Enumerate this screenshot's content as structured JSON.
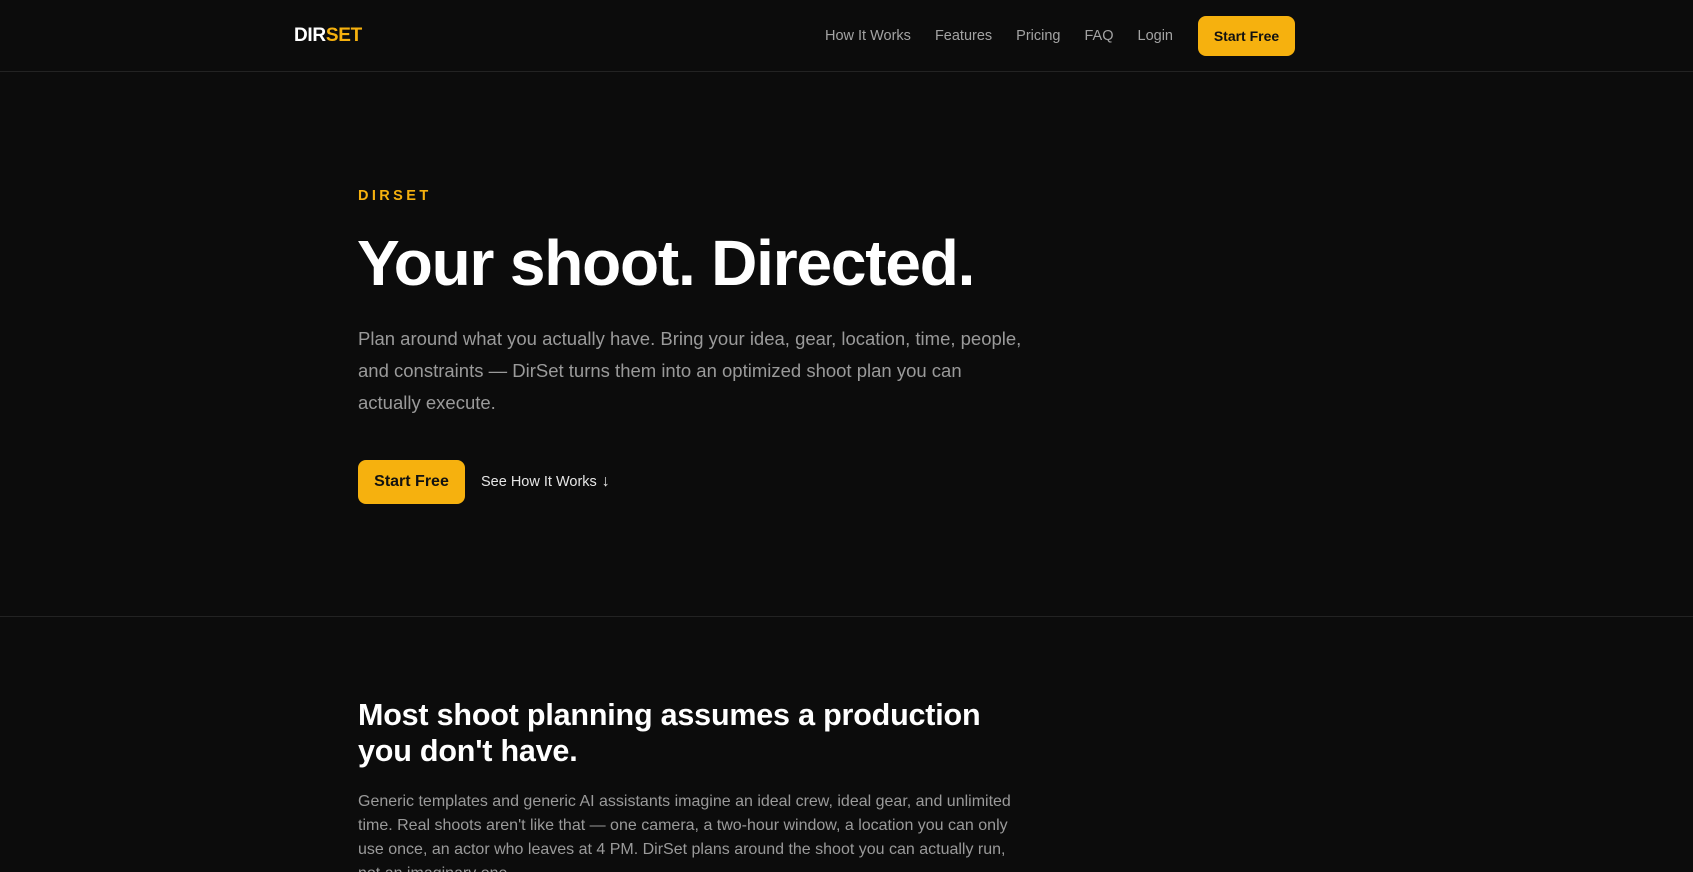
{
  "brand": {
    "logo_part1": "DIR",
    "logo_part2": "SET",
    "accent": "#f6b10e"
  },
  "nav": {
    "links": [
      "How It Works",
      "Features",
      "Pricing",
      "FAQ",
      "Login"
    ],
    "cta_label": "Start Free"
  },
  "hero": {
    "eyebrow": "DIRSET",
    "title": "Your shoot. Directed.",
    "subtitle": "Plan around what you actually have. Bring your idea, gear, location, time, people, and constraints — DirSet turns them into an optimized shoot plan you can actually execute.",
    "primary_cta": "Start Free",
    "secondary_cta": "See How It Works",
    "secondary_cta_icon": "↓"
  },
  "problem": {
    "title": "Most shoot planning assumes a production you don't have.",
    "body": "Generic templates and generic AI assistants imagine an ideal crew, ideal gear, and unlimited time. Real shoots aren't like that — one camera, a two-hour window, a location you can only use once, an actor who leaves at 4 PM. DirSet plans around the shoot you can actually run, not an imaginary one."
  }
}
